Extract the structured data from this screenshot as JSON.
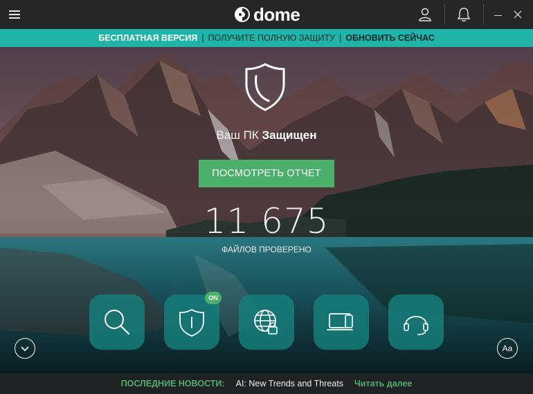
{
  "app": {
    "logo_text": "dome",
    "icons": {
      "menu": "hamburger-icon",
      "user": "user-icon",
      "bell": "bell-icon",
      "minimize": "minimize-icon",
      "close": "close-icon"
    }
  },
  "promo": {
    "free_version": "БЕСПЛАТНАЯ ВЕРСИЯ",
    "get_full": "ПОЛУЧИТЕ ПОЛНУЮ ЗАЩИТУ",
    "upgrade_now": "ОБНОВИТЬ СЕЙЧАС",
    "separator": "|"
  },
  "status": {
    "prefix": "Ваш ПК",
    "state": "Защищен",
    "report_button": "ПОСМОТРЕТЬ ОТЧЕТ",
    "files_scanned": "11 675",
    "files_scanned_label": "ФАЙЛОВ ПРОВЕРЕНО"
  },
  "modules": [
    {
      "icon": "search-icon"
    },
    {
      "icon": "shield-icon",
      "badge": "ON"
    },
    {
      "icon": "globe-lock-icon"
    },
    {
      "icon": "devices-icon"
    },
    {
      "icon": "headset-icon"
    }
  ],
  "controls": {
    "expand_icon": "chevron-down-icon",
    "font_size_label": "Aa"
  },
  "news": {
    "label": "ПОСЛЕДНИЕ НОВОСТИ:",
    "headline": "AI: New Trends and Threats",
    "read_more": "Читать далее"
  },
  "colors": {
    "accent_teal": "#20b3a8",
    "accent_green": "#4caf6b",
    "tile_teal": "#16807c",
    "titlebar": "#242628"
  }
}
